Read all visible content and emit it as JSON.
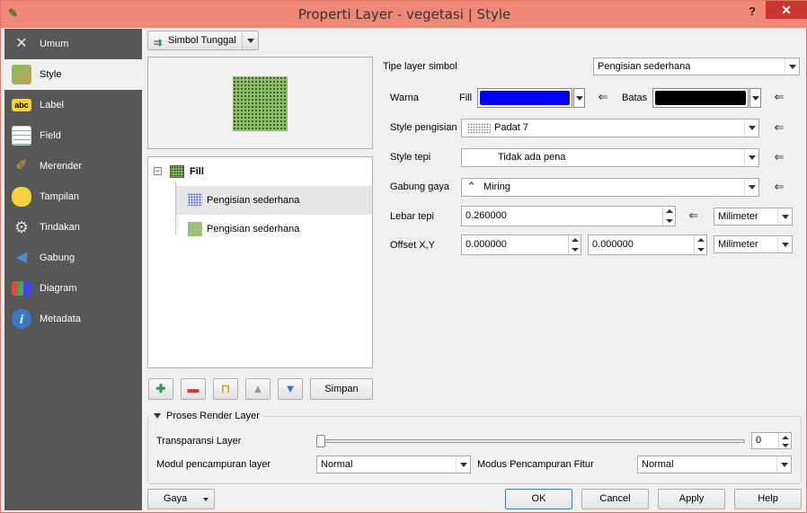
{
  "window": {
    "title": "Properti Layer - vegetasi | Style",
    "help": "?",
    "close": "✕"
  },
  "sidebar": {
    "items": [
      {
        "label": "Umum",
        "icon": "tools-icon"
      },
      {
        "label": "Style",
        "icon": "style-brush-icon"
      },
      {
        "label": "Label",
        "icon": "abc-label-icon"
      },
      {
        "label": "Field",
        "icon": "table-icon"
      },
      {
        "label": "Merender",
        "icon": "paintbrush-icon"
      },
      {
        "label": "Tampilan",
        "icon": "speech-bubble-icon"
      },
      {
        "label": "Tindakan",
        "icon": "gear-icon"
      },
      {
        "label": "Gabung",
        "icon": "join-arrow-icon"
      },
      {
        "label": "Diagram",
        "icon": "chart-icon"
      },
      {
        "label": "Metadata",
        "icon": "info-icon"
      }
    ]
  },
  "renderer": {
    "label": "Simbol Tunggal"
  },
  "tree": {
    "root": "Fill",
    "children": [
      "Pengisian sederhana",
      "Pengisian sederhana"
    ]
  },
  "toolbar": {
    "save_label": "Simpan"
  },
  "form": {
    "layer_type_label": "Tipe layer simbol",
    "layer_type_value": "Pengisian sederhana",
    "color_label": "Warna",
    "fill_label": "Fill",
    "border_label": "Batas",
    "fill_color": "#0000ff",
    "border_color": "#000000",
    "fill_style_label": "Style pengisian",
    "fill_style_value": "Padat 7",
    "edge_style_label": "Style tepi",
    "edge_style_value": "Tidak ada pena",
    "join_label": "Gabung gaya",
    "join_value": "Miring",
    "width_label": "Lebar tepi",
    "width_value": "0.260000",
    "width_unit": "Milimeter",
    "offset_label": "Offset X,Y",
    "offset_x": "0.000000",
    "offset_y": "0.000000",
    "offset_unit": "Milimeter"
  },
  "render": {
    "section_title": "Proses Render Layer",
    "transparency_label": "Transparansi Layer",
    "transparency_value": "0",
    "layer_blend_label": "Modul pencampuran layer",
    "layer_blend_value": "Normal",
    "feature_blend_label": "Modus Pencampuran Fitur",
    "feature_blend_value": "Normal"
  },
  "footer": {
    "style": "Gaya",
    "ok": "OK",
    "cancel": "Cancel",
    "apply": "Apply",
    "help": "Help"
  }
}
